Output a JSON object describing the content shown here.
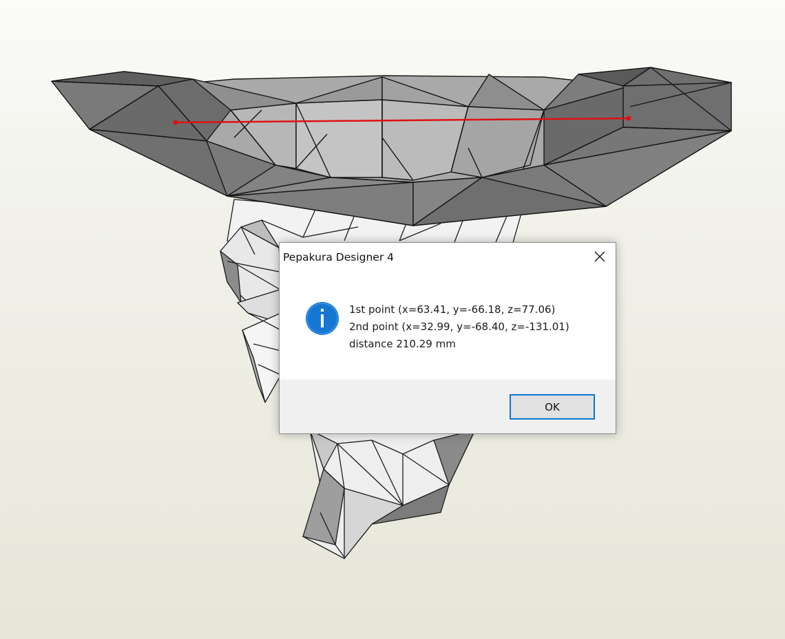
{
  "dialog": {
    "title": "Pepakura Designer 4",
    "icon": "information-icon",
    "lines": [
      "1st point (x=63.41, y=-66.18, z=77.06)",
      "2nd point (x=32.99, y=-68.40, z=-131.01)",
      "distance 210.29 mm"
    ],
    "ok_label": "OK"
  },
  "colors": {
    "measurement_line": "#e01010",
    "dialog_button_border": "#0a74d4",
    "info_icon": "#1677d2"
  }
}
